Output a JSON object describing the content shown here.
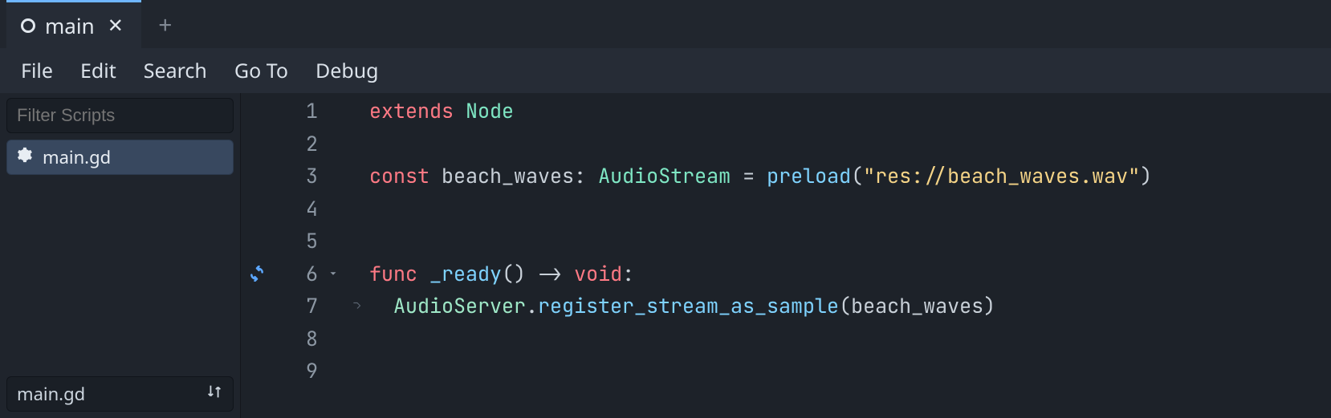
{
  "tab": {
    "title": "main"
  },
  "menus": {
    "file": "File",
    "edit": "Edit",
    "search": "Search",
    "goto": "Go To",
    "debug": "Debug"
  },
  "sidebar": {
    "filter_placeholder": "Filter Scripts",
    "items": [
      {
        "label": "main.gd"
      }
    ],
    "bottom_label": "main.gd"
  },
  "code": {
    "lines": {
      "1": {
        "n": "1",
        "kw": "extends",
        "type": "Node"
      },
      "2": {
        "n": "2"
      },
      "3": {
        "n": "3",
        "kw": "const",
        "id": "beach_waves",
        "colon": ":",
        "type": "AudioStream",
        "eq": "=",
        "preload": "preload",
        "lp": "(",
        "str": "\"res://beach_waves.wav\"",
        "rp": ")"
      },
      "4": {
        "n": "4"
      },
      "5": {
        "n": "5"
      },
      "6": {
        "n": "6",
        "kw": "func",
        "fn": "_ready",
        "paren": "()",
        "arrow": "->",
        "void": "void",
        "colon": ":"
      },
      "7": {
        "n": "7",
        "cls": "AudioServer",
        "dot": ".",
        "fn": "register_stream_as_sample",
        "lp": "(",
        "arg": "beach_waves",
        "rp": ")"
      },
      "8": {
        "n": "8"
      },
      "9": {
        "n": "9"
      }
    }
  }
}
